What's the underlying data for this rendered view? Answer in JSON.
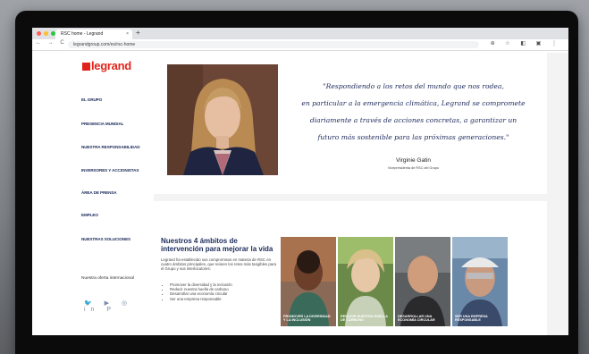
{
  "browser": {
    "tab_title": "RSC home - Legrand",
    "tab_close": "×",
    "new_tab": "+",
    "nav_buttons": "← → C ⌂",
    "url": "legrandgroup.com/es/rsc-home",
    "right_icons": "⊕ ☆ ◧ ▣ ⋮"
  },
  "sidebar": {
    "logo_text": "legrand",
    "items": [
      {
        "label": "EL GRUPO"
      },
      {
        "label": "PRESENCIA MUNDIAL"
      },
      {
        "label": "NUESTRA RESPONSABILIDAD"
      },
      {
        "label": "INVERSORES Y ACCIONISTAS"
      },
      {
        "label": "ÁREA DE PRENSA"
      },
      {
        "label": "EMPLEO"
      },
      {
        "label": "NUESTRAS SOLUCIONES"
      }
    ],
    "international_link": "Nuestra oferta internacional",
    "social": "🐦 ▶ ◎ in P"
  },
  "quote": {
    "text_lines": [
      "\"Respondiendo a los retos del mundo que nos rodea,",
      "en particular a la emergencia climática, Legrand se compromete",
      "diariamente a través de acciones concretas, a garantizar un",
      "futuro más sostenible para las próximas generaciones.\""
    ],
    "name": "Virginie Gatin",
    "role": "Vicepresidenta de RSC del Grupo"
  },
  "ambitos": {
    "title": "Nuestros 4 ámbitos de intervención para mejorar la vida",
    "description": "Legrand ha establecido sus compromisos en materia de RSC en cuatro ámbitos principales, que reúnen los retos más tangibles para el Grupo y sus interlocutores:",
    "list": [
      "Promover la diversidad y la inclusión",
      "Reducir nuestra huella de carbono",
      "Desarrollar una economía circular",
      "Ser una empresa responsable"
    ],
    "cards": [
      {
        "label": "PROMOVER LA DIVERSIDAD Y LA INCLUSIÓN"
      },
      {
        "label": "REDUCIR NUESTRA HUELLA DE CARBONO"
      },
      {
        "label": "DESARROLLAR UNA ECONOMÍA CIRCULAR"
      },
      {
        "label": "SER UNA EMPRESA RESPONSABLE"
      }
    ]
  },
  "colors": {
    "brand_red": "#e2231a",
    "navy": "#1a2a5a"
  }
}
